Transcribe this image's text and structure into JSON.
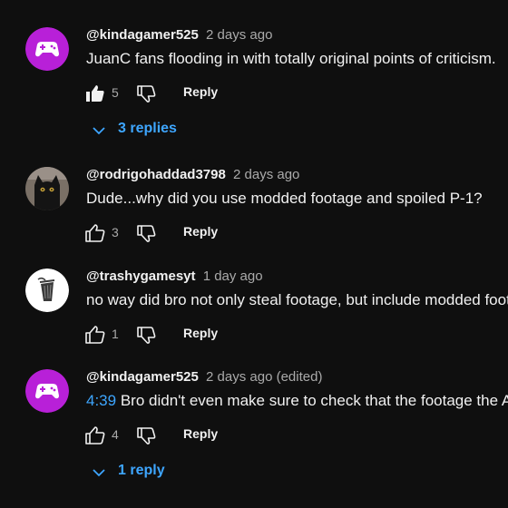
{
  "comments": [
    {
      "handle": "@kindagamer525",
      "date": "2 days ago",
      "text": "JuanC fans flooding in with totally original points of criticism.",
      "likes": "5",
      "reply_label": "Reply",
      "avatar": "controller-avatar",
      "liked": true,
      "replies_label": "3 replies"
    },
    {
      "handle": "@rodrigohaddad3798",
      "date": "2 days ago",
      "text": "Dude...why did you use modded footage and spoiled P-1?",
      "likes": "3",
      "reply_label": "Reply",
      "avatar": "cat-photo-avatar"
    },
    {
      "handle": "@trashygamesyt",
      "date": "1 day ago",
      "text": "no way did bro not only steal footage, but include modded foota",
      "likes": "1",
      "reply_label": "Reply",
      "avatar": "trash-can-avatar"
    },
    {
      "handle": "@kindagamer525",
      "date": "2 days ago (edited)",
      "timestamp": "4:39",
      "text": "Bro didn't even make sure to check that the footage the AI",
      "likes": "4",
      "reply_label": "Reply",
      "avatar": "controller-avatar",
      "replies_label": "1 reply"
    }
  ],
  "colors": {
    "background": "#0f0f0f",
    "link": "#3ea6ff",
    "secondary_text": "#aaaaaa",
    "avatar_purple": "#b820d8"
  }
}
